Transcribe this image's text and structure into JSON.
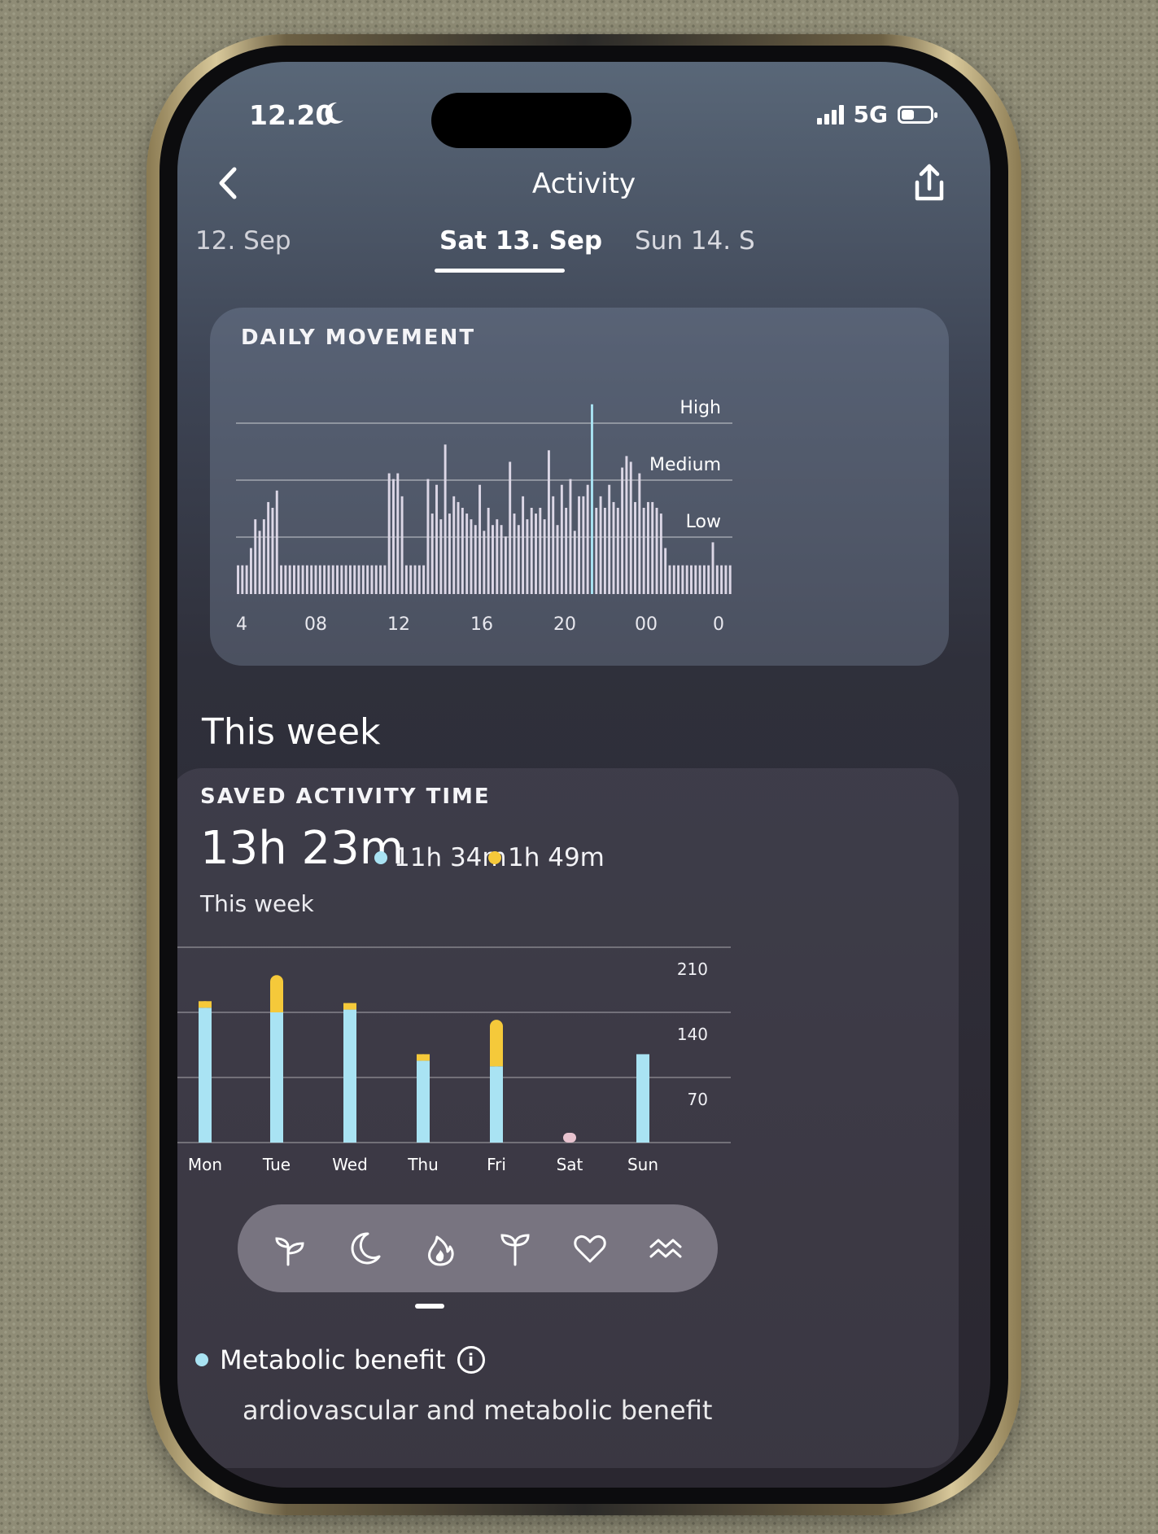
{
  "status": {
    "time": "12.20",
    "network": "5G",
    "battery_level": 0.45
  },
  "nav": {
    "title": "Activity",
    "back_icon": "chevron-left-icon",
    "share_icon": "share-icon"
  },
  "dates": {
    "prev": "12. Sep",
    "current": "Sat 13. Sep",
    "next": "Sun 14. S"
  },
  "daily_movement": {
    "label": "DAILY MOVEMENT",
    "chart_data": {
      "type": "bar",
      "title": "DAILY MOVEMENT",
      "y_levels": [
        "High",
        "Medium",
        "Low"
      ],
      "x_ticks": [
        "4",
        "08",
        "12",
        "16",
        "20",
        "00",
        "0"
      ],
      "ylim": [
        0,
        3
      ],
      "values": [
        0.5,
        0.5,
        0.5,
        0.8,
        1.3,
        1.1,
        1.3,
        1.6,
        1.5,
        1.8,
        0.5,
        0.5,
        0.5,
        0.5,
        0.5,
        0.5,
        0.5,
        0.5,
        0.5,
        0.5,
        0.5,
        0.5,
        0.5,
        0.5,
        0.5,
        0.5,
        0.5,
        0.5,
        0.5,
        0.5,
        0.5,
        0.5,
        0.5,
        0.5,
        0.5,
        2.1,
        2.0,
        2.1,
        1.7,
        0.5,
        0.5,
        0.5,
        0.5,
        0.5,
        2.0,
        1.4,
        1.9,
        1.3,
        2.6,
        1.4,
        1.7,
        1.6,
        1.5,
        1.4,
        1.3,
        1.2,
        1.9,
        1.1,
        1.5,
        1.2,
        1.3,
        1.2,
        1.0,
        2.3,
        1.4,
        1.2,
        1.7,
        1.3,
        1.5,
        1.4,
        1.5,
        1.3,
        2.5,
        1.7,
        1.2,
        1.9,
        1.5,
        2.0,
        1.1,
        1.7,
        1.7,
        1.9,
        3.3,
        1.5,
        1.7,
        1.5,
        1.9,
        1.6,
        1.5,
        2.2,
        2.4,
        2.3,
        1.6,
        2.1,
        1.5,
        1.6,
        1.6,
        1.5,
        1.4,
        0.8,
        0.5,
        0.5,
        0.5,
        0.5,
        0.5,
        0.5,
        0.5,
        0.5,
        0.5,
        0.5,
        0.9,
        0.5,
        0.5,
        0.5,
        0.5
      ],
      "highlight_index": 82,
      "grid": true
    }
  },
  "this_week": {
    "title": "This week",
    "saved": {
      "label": "SAVED ACTIVITY TIME",
      "total": "13h 23m",
      "blue_total": "11h 34m",
      "yellow_total": "1h 49m",
      "subtitle": "This week",
      "colors": {
        "blue": "#a9e3f3",
        "yellow": "#f5c93a",
        "pending": "#e8c3cf"
      },
      "chart_data": {
        "type": "bar",
        "stacked": true,
        "categories": [
          "Mon",
          "Tue",
          "Wed",
          "Thu",
          "Fri",
          "Sat",
          "Sun"
        ],
        "series": [
          {
            "values": [
              145,
              140,
              143,
              88,
              82,
              0,
              95
            ]
          },
          {
            "values": [
              7,
              40,
              7,
              7,
              50,
              0,
              0
            ]
          }
        ],
        "sat_marker": 12,
        "y_ticks": [
          70,
          140,
          210
        ],
        "ylim": [
          0,
          210
        ],
        "grid": true
      }
    }
  },
  "tabbar": {
    "tabs": [
      {
        "icon": "readiness-icon"
      },
      {
        "icon": "sleep-moon-icon"
      },
      {
        "icon": "activity-flame-icon",
        "active": true
      },
      {
        "icon": "stress-sprout-icon"
      },
      {
        "icon": "heart-icon"
      },
      {
        "icon": "resilience-waves-icon"
      }
    ]
  },
  "footer": {
    "metabolic_label": "Metabolic benefit",
    "info_icon_label": "i",
    "cut_text": "ardiovascular and metabolic benefit"
  }
}
